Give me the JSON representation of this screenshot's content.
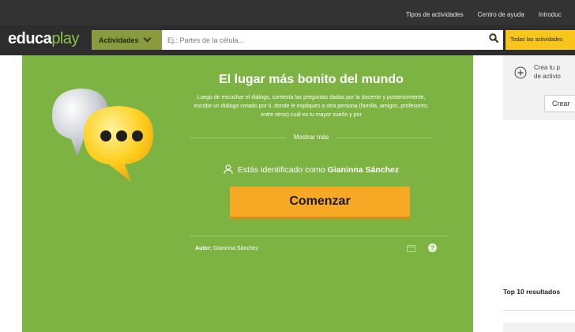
{
  "topbar": {
    "links": [
      "Tipos de actividades",
      "Centro de ayuda",
      "Introduc"
    ]
  },
  "navbar": {
    "logo_bold": "educa",
    "logo_light": "play",
    "activities_button": "Actividades",
    "search_placeholder": "Ej.: Partes de la célula...",
    "all_activities_button": "Todas las actividades"
  },
  "activity": {
    "title": "El lugar más bonito del mundo",
    "description": "Luego de escuchar el diálogo, contesta las preguntas dadas por la docente y posteriormente, escribe un diálogo creado por ti, donde le expliques a otra persona (familia, amigos, profesores, entre otros) cuál es tu mayor sueño y por",
    "show_more": "Mostrar más",
    "identified_prefix": "Estás identificado como",
    "user_name": "Gianinna Sánchez",
    "start_button": "Comenzar",
    "author_label": "Autor:",
    "author_name": "Gianinna Sánchez"
  },
  "sidebar": {
    "create_line1": "Crea tu p",
    "create_line2": "de activio",
    "create_button": "Crear",
    "top10_title": "Top 10 resultados"
  },
  "colors": {
    "topbar": "#333333",
    "navbar": "#2d2d2d",
    "activity_panel": "#7cb342",
    "start_button": "#f7a825",
    "all_activities": "#f7c51c"
  }
}
